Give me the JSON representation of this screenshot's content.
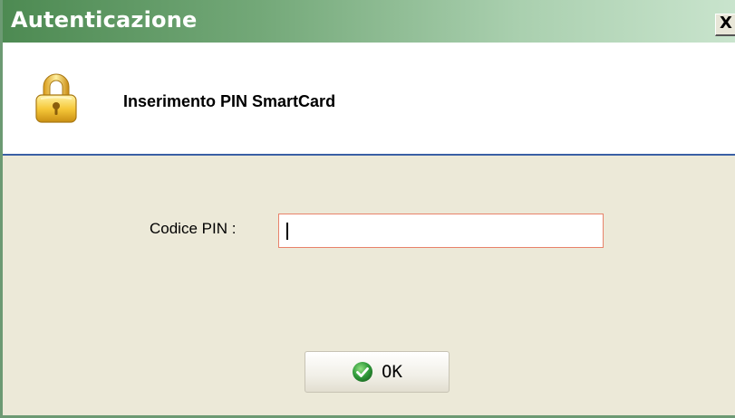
{
  "window": {
    "title": "Autenticazione",
    "close_glyph": "X"
  },
  "header": {
    "icon": "lock-icon",
    "title": "Inserimento PIN SmartCard"
  },
  "form": {
    "pin_label": "Codice PIN :",
    "pin_value": ""
  },
  "actions": {
    "ok_label": "OK",
    "ok_icon": "check-icon"
  },
  "colors": {
    "titlebar_start": "#4d8a52",
    "titlebar_end": "#c9e4cd",
    "header_separator": "#3a5fa5",
    "input_border": "#e8826a",
    "dialog_background": "#ece9d8",
    "ok_icon_green": "#2f9a3a"
  }
}
